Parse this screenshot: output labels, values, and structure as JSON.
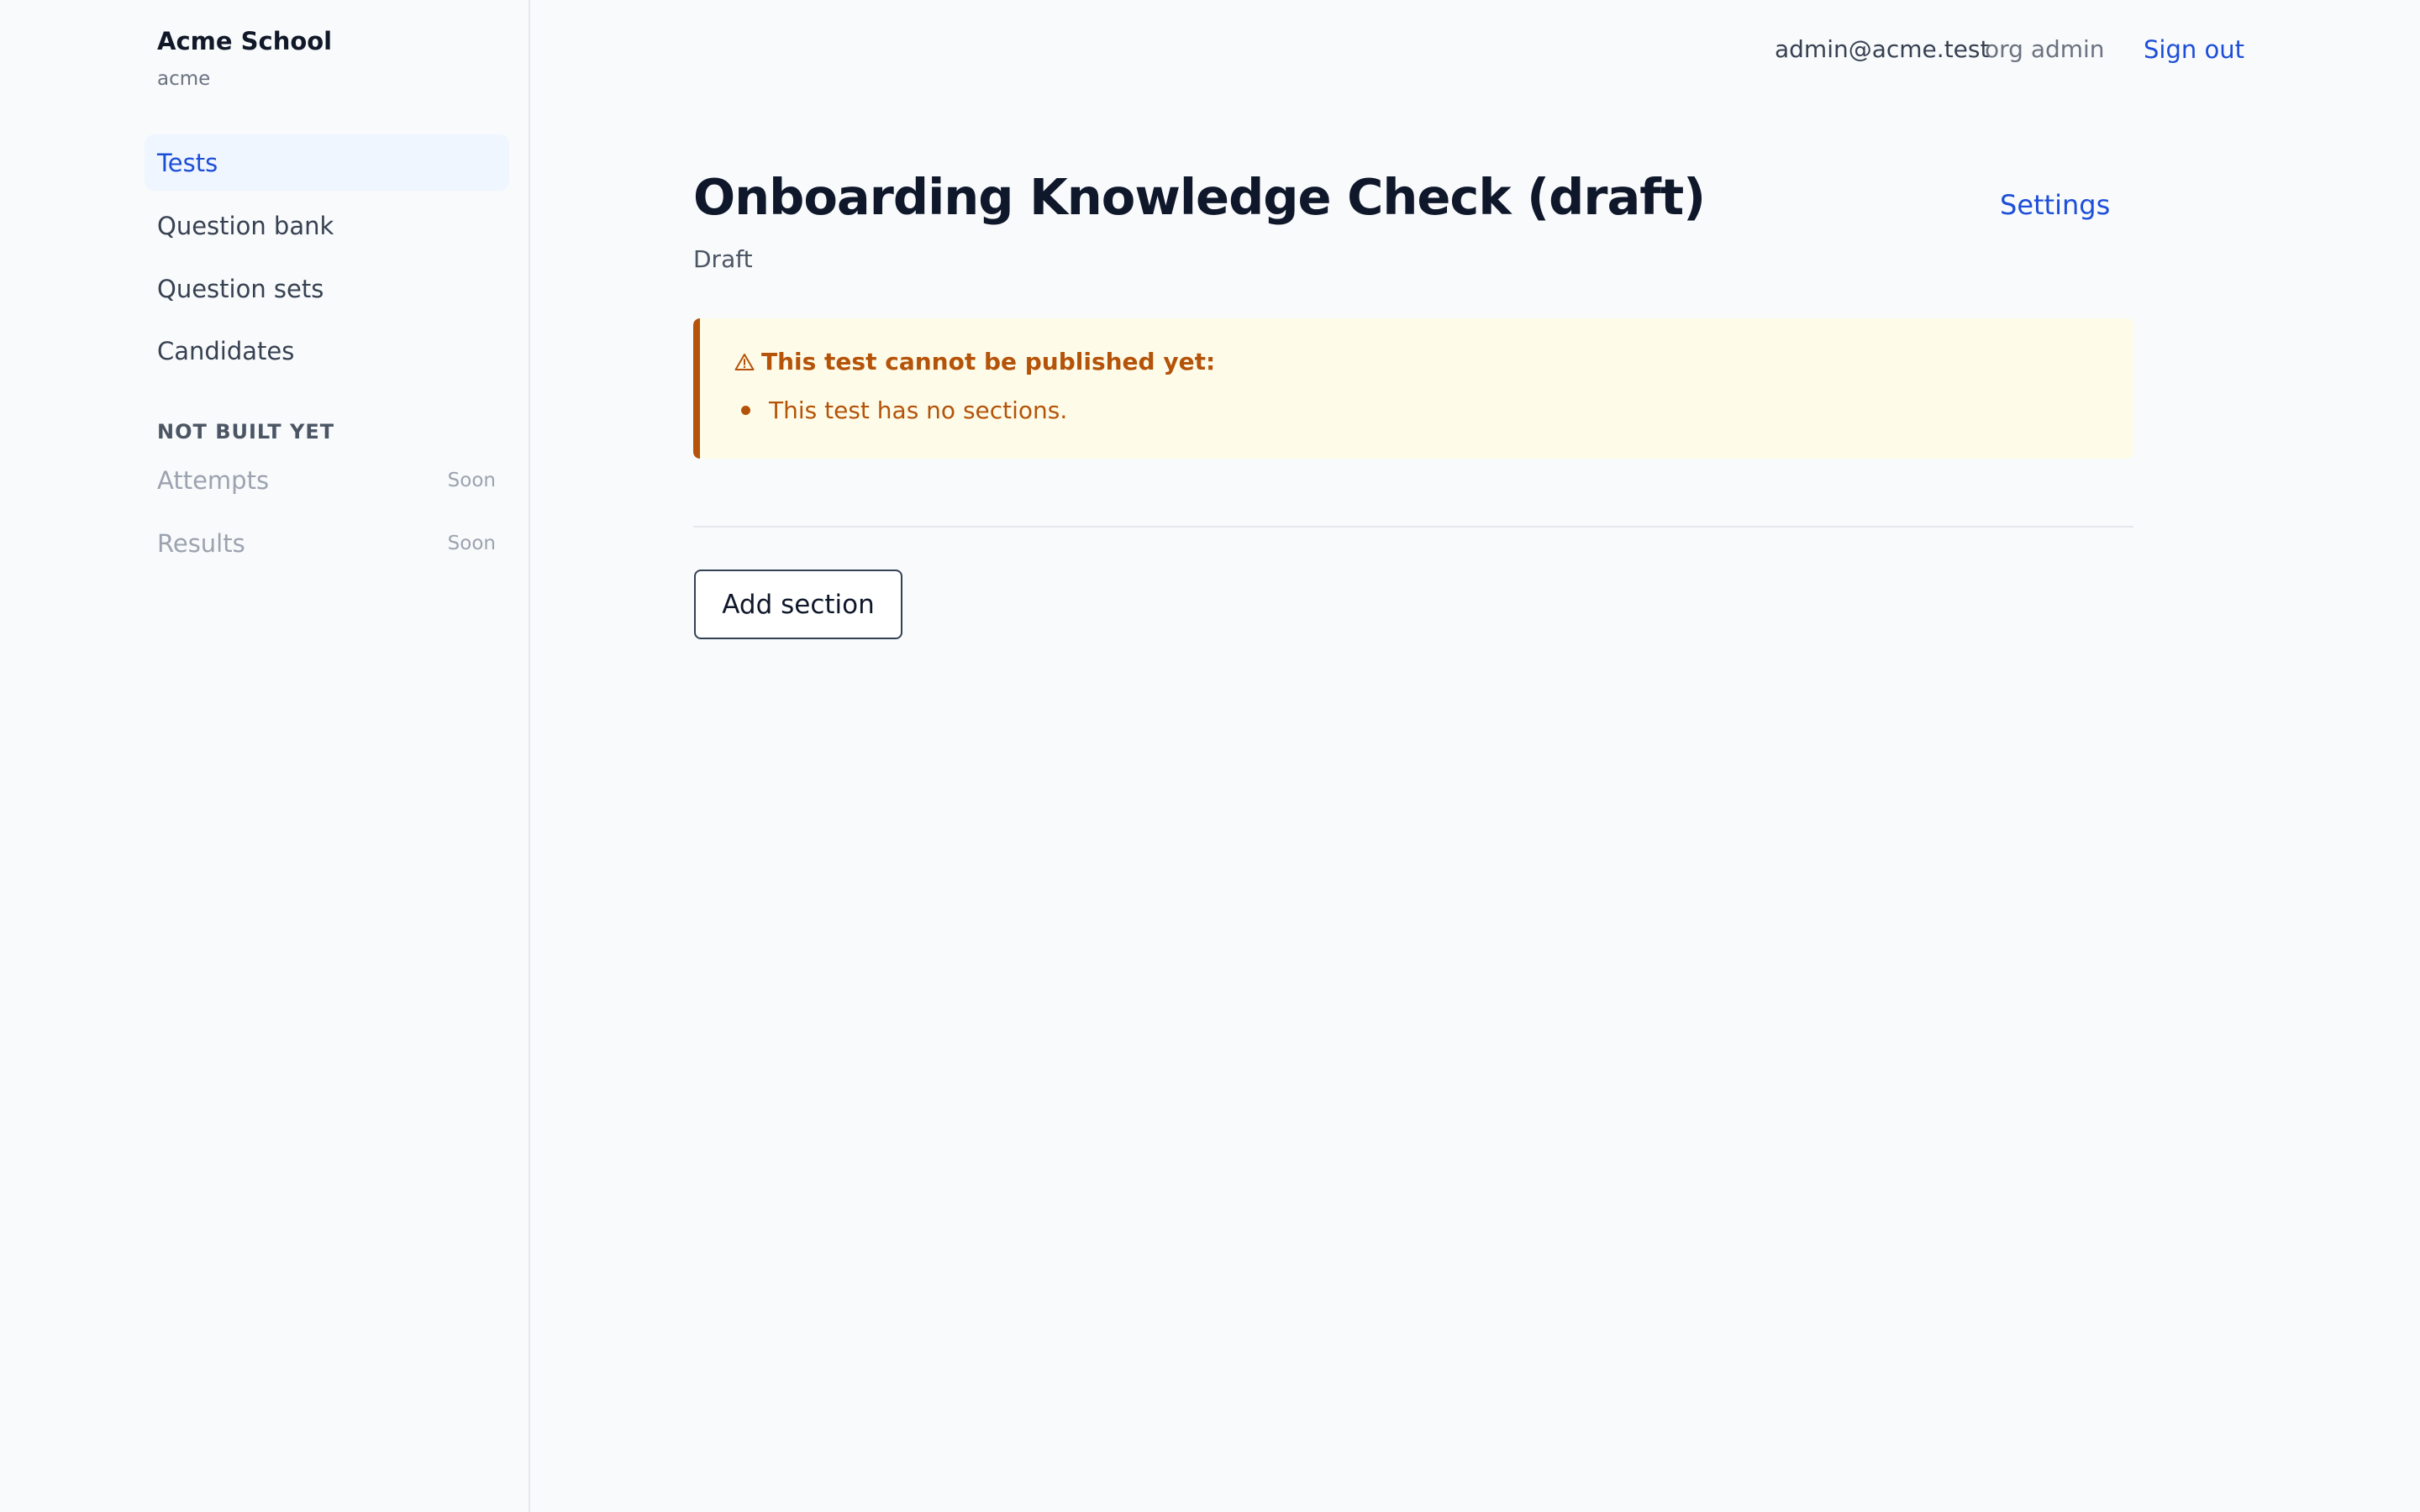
{
  "sidebar": {
    "org_name": "Acme School",
    "org_slug": "acme",
    "nav": [
      {
        "label": "Tests"
      },
      {
        "label": "Question bank"
      },
      {
        "label": "Question sets"
      },
      {
        "label": "Candidates"
      }
    ],
    "section_label": "NOT BUILT YET",
    "disabled_nav": [
      {
        "label": "Attempts",
        "badge": "Soon"
      },
      {
        "label": "Results",
        "badge": "Soon"
      }
    ]
  },
  "topbar": {
    "email": "admin@acme.test",
    "role": "org admin",
    "sign_out": "Sign out"
  },
  "main": {
    "title": "Onboarding Knowledge Check (draft)",
    "status": "Draft",
    "settings_label": "Settings",
    "alert": {
      "icon": "warning-icon",
      "title": "This test cannot be published yet:",
      "items": [
        "This test has no sections."
      ]
    },
    "add_section_label": "Add section"
  },
  "colors": {
    "background": "#f8fafc",
    "accent": "#1d4ed8",
    "active_nav_bg": "#eff6ff",
    "warning": "#b45309",
    "warning_bg": "#fefce8"
  }
}
